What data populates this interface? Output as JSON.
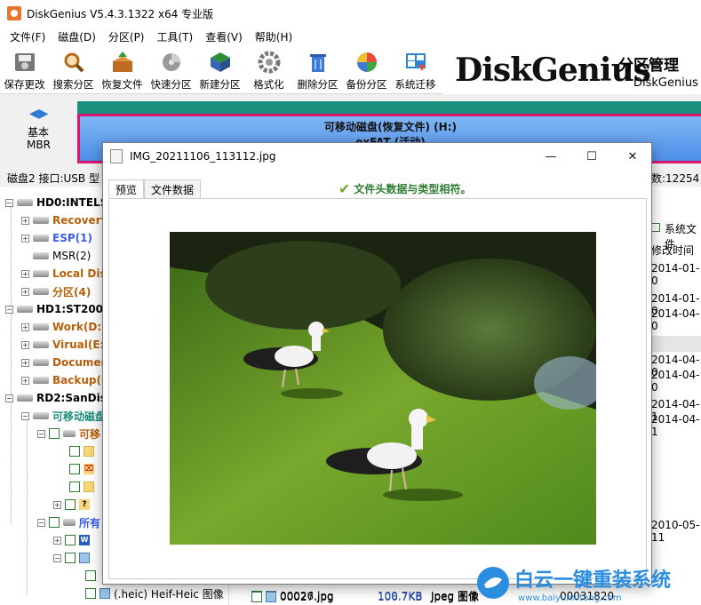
{
  "app": {
    "title": "DiskGenius V5.4.3.1322 x64 专业版"
  },
  "menu": [
    "文件(F)",
    "磁盘(D)",
    "分区(P)",
    "工具(T)",
    "查看(V)",
    "帮助(H)"
  ],
  "toolbar": [
    {
      "label": "保存更改",
      "icon": "save-disk-icon"
    },
    {
      "label": "搜索分区",
      "icon": "magnifier-icon"
    },
    {
      "label": "恢复文件",
      "icon": "recover-box-icon"
    },
    {
      "label": "快速分区",
      "icon": "quick-partition-icon"
    },
    {
      "label": "新建分区",
      "icon": "new-partition-icon"
    },
    {
      "label": "格式化",
      "icon": "format-icon"
    },
    {
      "label": "删除分区",
      "icon": "delete-partition-icon"
    },
    {
      "label": "备份分区",
      "icon": "backup-pie-icon"
    },
    {
      "label": "系统迁移",
      "icon": "system-migrate-icon"
    }
  ],
  "banner": {
    "logo": "DiskGenius",
    "tagline1": "分区管理 ",
    "tagline2": "DiskGenius"
  },
  "disk_nav": {
    "type": "基本",
    "scheme": "MBR"
  },
  "partition_block": {
    "line1": "可移动磁盘(恢复文件) (H:)",
    "line2": "exFAT (活动)"
  },
  "infobar": {
    "left": "磁盘2 接口:USB  型",
    "right": "数:12254"
  },
  "tree": [
    {
      "label": "HD0:INTELSS",
      "style": "bold",
      "type": "disk"
    },
    {
      "label": "Recovery",
      "style": "orange",
      "type": "part"
    },
    {
      "label": "ESP(1)",
      "style": "blue",
      "type": "part"
    },
    {
      "label": "MSR(2)",
      "style": "plain",
      "type": "part"
    },
    {
      "label": "Local Dis",
      "style": "orange",
      "type": "part"
    },
    {
      "label": "分区(4)",
      "style": "orange",
      "type": "part"
    },
    {
      "label": "HD1:ST2000I",
      "style": "bold",
      "type": "disk"
    },
    {
      "label": "Work(D:)",
      "style": "orange",
      "type": "part"
    },
    {
      "label": "Virual(E:)",
      "style": "orange",
      "type": "part"
    },
    {
      "label": "Documen",
      "style": "orange",
      "type": "part"
    },
    {
      "label": "Backup(G",
      "style": "orange",
      "type": "part"
    },
    {
      "label": "RD2:SanDisk",
      "style": "bold",
      "type": "disk"
    },
    {
      "label": "可移动磁盘",
      "style": "teal",
      "type": "part"
    },
    {
      "label": "可移",
      "style": "orange",
      "type": "folder"
    },
    {
      "label": "所有",
      "style": "blue",
      "type": "folder"
    },
    {
      "label": "(.heic) Heif-Heic 图像",
      "style": "plain",
      "type": "file"
    }
  ],
  "right_panel": {
    "sys_file_label": "系统文件",
    "mod_time_label": "修改时间",
    "dates": [
      "2014-01-0",
      "2014-01-0",
      "2014-04-0",
      "2014-04-0",
      "2014-04-0",
      "2014-04-1",
      "2014-04-1",
      "2010-05-11"
    ]
  },
  "file_rows": [
    {
      "name": "00026.jpg",
      "size": "100.7KB",
      "type": "Jpeg 图像",
      "sector": "00031820"
    },
    {
      "name": "00027.jpg",
      "size": "106.7KB",
      "type": "Jpeg 图像",
      "sector": "00031868"
    }
  ],
  "dialog": {
    "title": "IMG_20211106_113112.jpg",
    "tabs": [
      "预览",
      "文件数据"
    ],
    "message": "文件头数据与类型相符。",
    "win_minimize": "—",
    "win_maximize": "☐",
    "win_close": "✕"
  },
  "watermark": {
    "cn": "白云一键重装系统",
    "url": "www.baiyunxitong.com"
  },
  "colors": {
    "accent_teal": "#1b8f7d",
    "partition_border": "#d7196e",
    "partition_fill": "#6aa5f0",
    "match_green": "#2e7d32"
  }
}
